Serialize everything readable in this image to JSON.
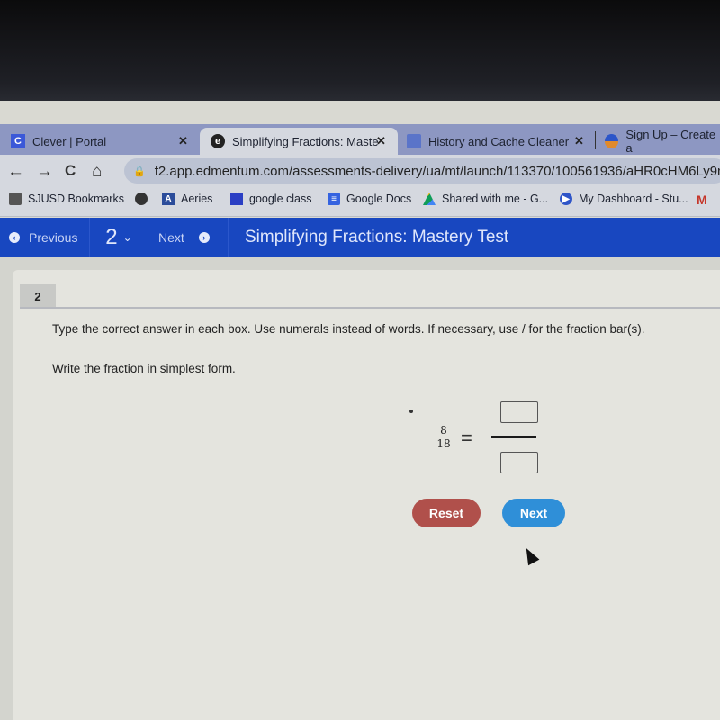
{
  "browser": {
    "tabs": [
      {
        "label": "Clever | Portal",
        "favicon": "clever-icon",
        "active": false,
        "closable": true
      },
      {
        "label": "Simplifying Fractions: Maste",
        "favicon": "edmentum-icon",
        "active": true,
        "closable": true
      },
      {
        "label": "History and Cache Cleaner",
        "favicon": "extension-icon",
        "active": false,
        "closable": true
      },
      {
        "label": "Sign Up – Create a",
        "favicon": "google-icon",
        "active": false,
        "closable": false
      }
    ],
    "nav": {
      "back": "←",
      "forward": "→",
      "reload": "C",
      "home": "⌂"
    },
    "url": "f2.app.edmentum.com/assessments-delivery/ua/mt/launch/113370/100561936/aHR0cHM6Ly9mM",
    "bookmarks": [
      {
        "label": "SJUSD Bookmarks",
        "icon": "folder-icon"
      },
      {
        "label": "",
        "icon": "globe-icon"
      },
      {
        "label": "Aeries",
        "icon": "aeries-icon"
      },
      {
        "label": "google class",
        "icon": "classroom-icon"
      },
      {
        "label": "Google Docs",
        "icon": "docs-icon"
      },
      {
        "label": "Shared with me - G...",
        "icon": "drive-icon"
      },
      {
        "label": "My Dashboard - Stu...",
        "icon": "dashboard-icon"
      },
      {
        "label": "M",
        "icon": "gmail-icon"
      }
    ]
  },
  "appbar": {
    "previous_label": "Previous",
    "question_number": "2",
    "next_label": "Next",
    "title": "Simplifying Fractions: Mastery Test",
    "color": "#1847c0"
  },
  "question": {
    "number": "2",
    "instruction": "Type the correct answer in each box. Use numerals instead of words. If necessary, use / for the fraction bar(s).",
    "prompt": "Write the fraction in simplest form.",
    "fraction": {
      "numerator": "8",
      "denominator": "18"
    },
    "equals": "=",
    "answer": {
      "numerator": "",
      "denominator": ""
    },
    "reset_label": "Reset",
    "next_label": "Next",
    "reset_color": "#b0504b",
    "next_color": "#2f8fd8"
  }
}
